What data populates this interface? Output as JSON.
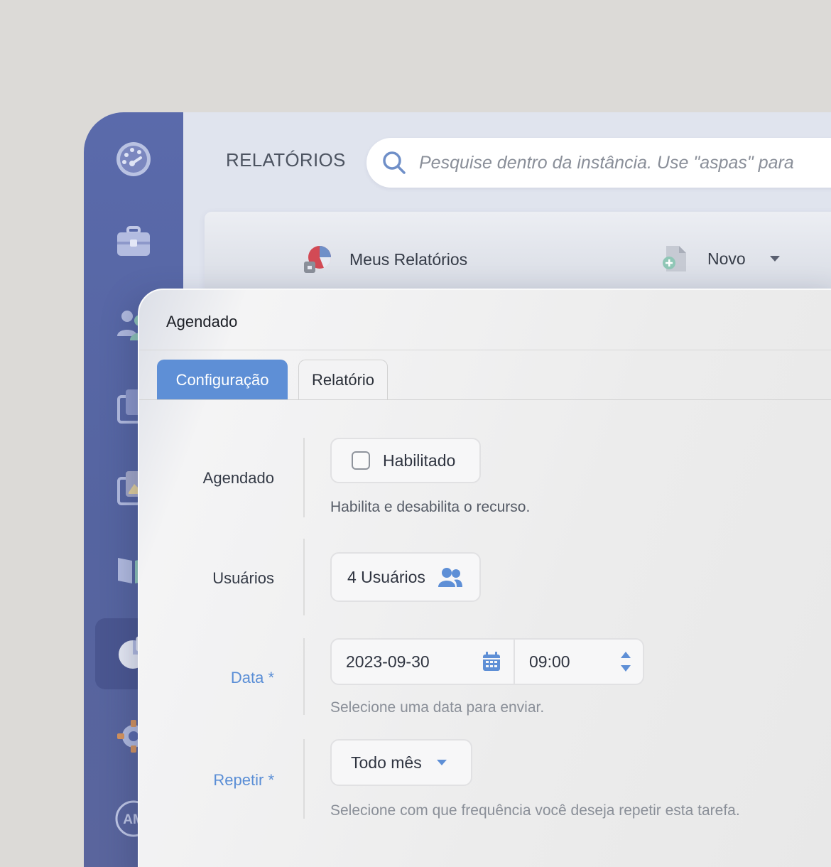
{
  "header": {
    "title": "RELATÓRIOS",
    "search_placeholder": "Pesquise dentro da instância. Use \"aspas\" para"
  },
  "sidebar": {
    "items": [
      {
        "icon": "dashboard-gauge-icon"
      },
      {
        "icon": "briefcase-icon"
      },
      {
        "icon": "users-icon"
      },
      {
        "icon": "documents-icon"
      },
      {
        "icon": "image-gallery-icon"
      },
      {
        "icon": "book-icon"
      },
      {
        "icon": "reports-pie-icon",
        "active": true
      },
      {
        "icon": "gear-icon"
      },
      {
        "icon": "avatar",
        "initials": "AM"
      }
    ]
  },
  "subnav": {
    "my_reports": "Meus Relatórios",
    "new": "Novo"
  },
  "modal": {
    "title": "Agendado",
    "tabs": [
      {
        "label": "Configuração",
        "active": true
      },
      {
        "label": "Relatório",
        "active": false
      }
    ],
    "fields": {
      "scheduled": {
        "label": "Agendado",
        "checkbox_label": "Habilitado",
        "checked": false,
        "help": "Habilita e desabilita o recurso."
      },
      "users": {
        "label": "Usuários",
        "value": "4 Usuários"
      },
      "date": {
        "label": "Data",
        "required_mark": "*",
        "date_value": "2023-09-30",
        "time_value": "09:00",
        "help": "Selecione uma data para enviar."
      },
      "repeat": {
        "label": "Repetir",
        "required_mark": "*",
        "value": "Todo mês",
        "help": "Selecione com que frequência você deseja repetir esta tarefa."
      }
    }
  },
  "colors": {
    "sidebar": "#5a6aab",
    "accent": "#5e8fd6",
    "required_label": "#5a8ed6"
  }
}
